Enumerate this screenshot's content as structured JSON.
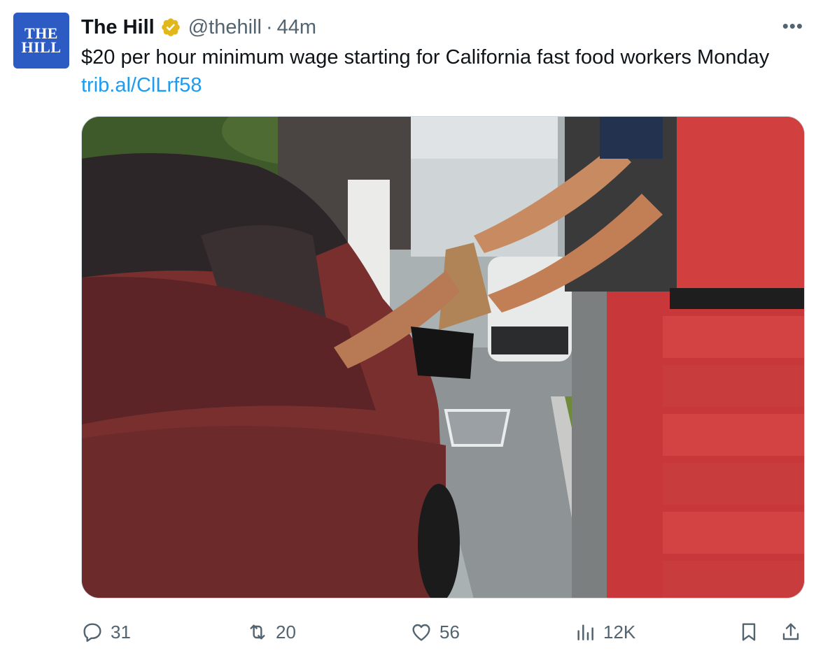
{
  "account": {
    "avatar_line1": "THE",
    "avatar_line2": "HILL",
    "display_name": "The Hill",
    "handle": "@thehill",
    "separator": "·",
    "time": "44m"
  },
  "tweet": {
    "text": "$20 per hour minimum wage starting for California fast food workers Monday",
    "link": "trib.al/ClLrf58"
  },
  "media": {
    "subject": "drive-thru worker handing paper bag to driver"
  },
  "actions": {
    "replies": "31",
    "reposts": "20",
    "likes": "56",
    "views": "12K"
  },
  "icons": {
    "verified": "verified-badge-gold",
    "more": "more-dots-icon",
    "reply": "reply-icon",
    "repost": "repost-icon",
    "like": "heart-icon",
    "views": "views-chart-icon",
    "bookmark": "bookmark-icon",
    "share": "share-icon"
  },
  "colors": {
    "link": "#1d9bf0",
    "secondary_text": "#536471",
    "avatar_bg": "#2c5bc4",
    "verified_gold": "#e2b719"
  }
}
